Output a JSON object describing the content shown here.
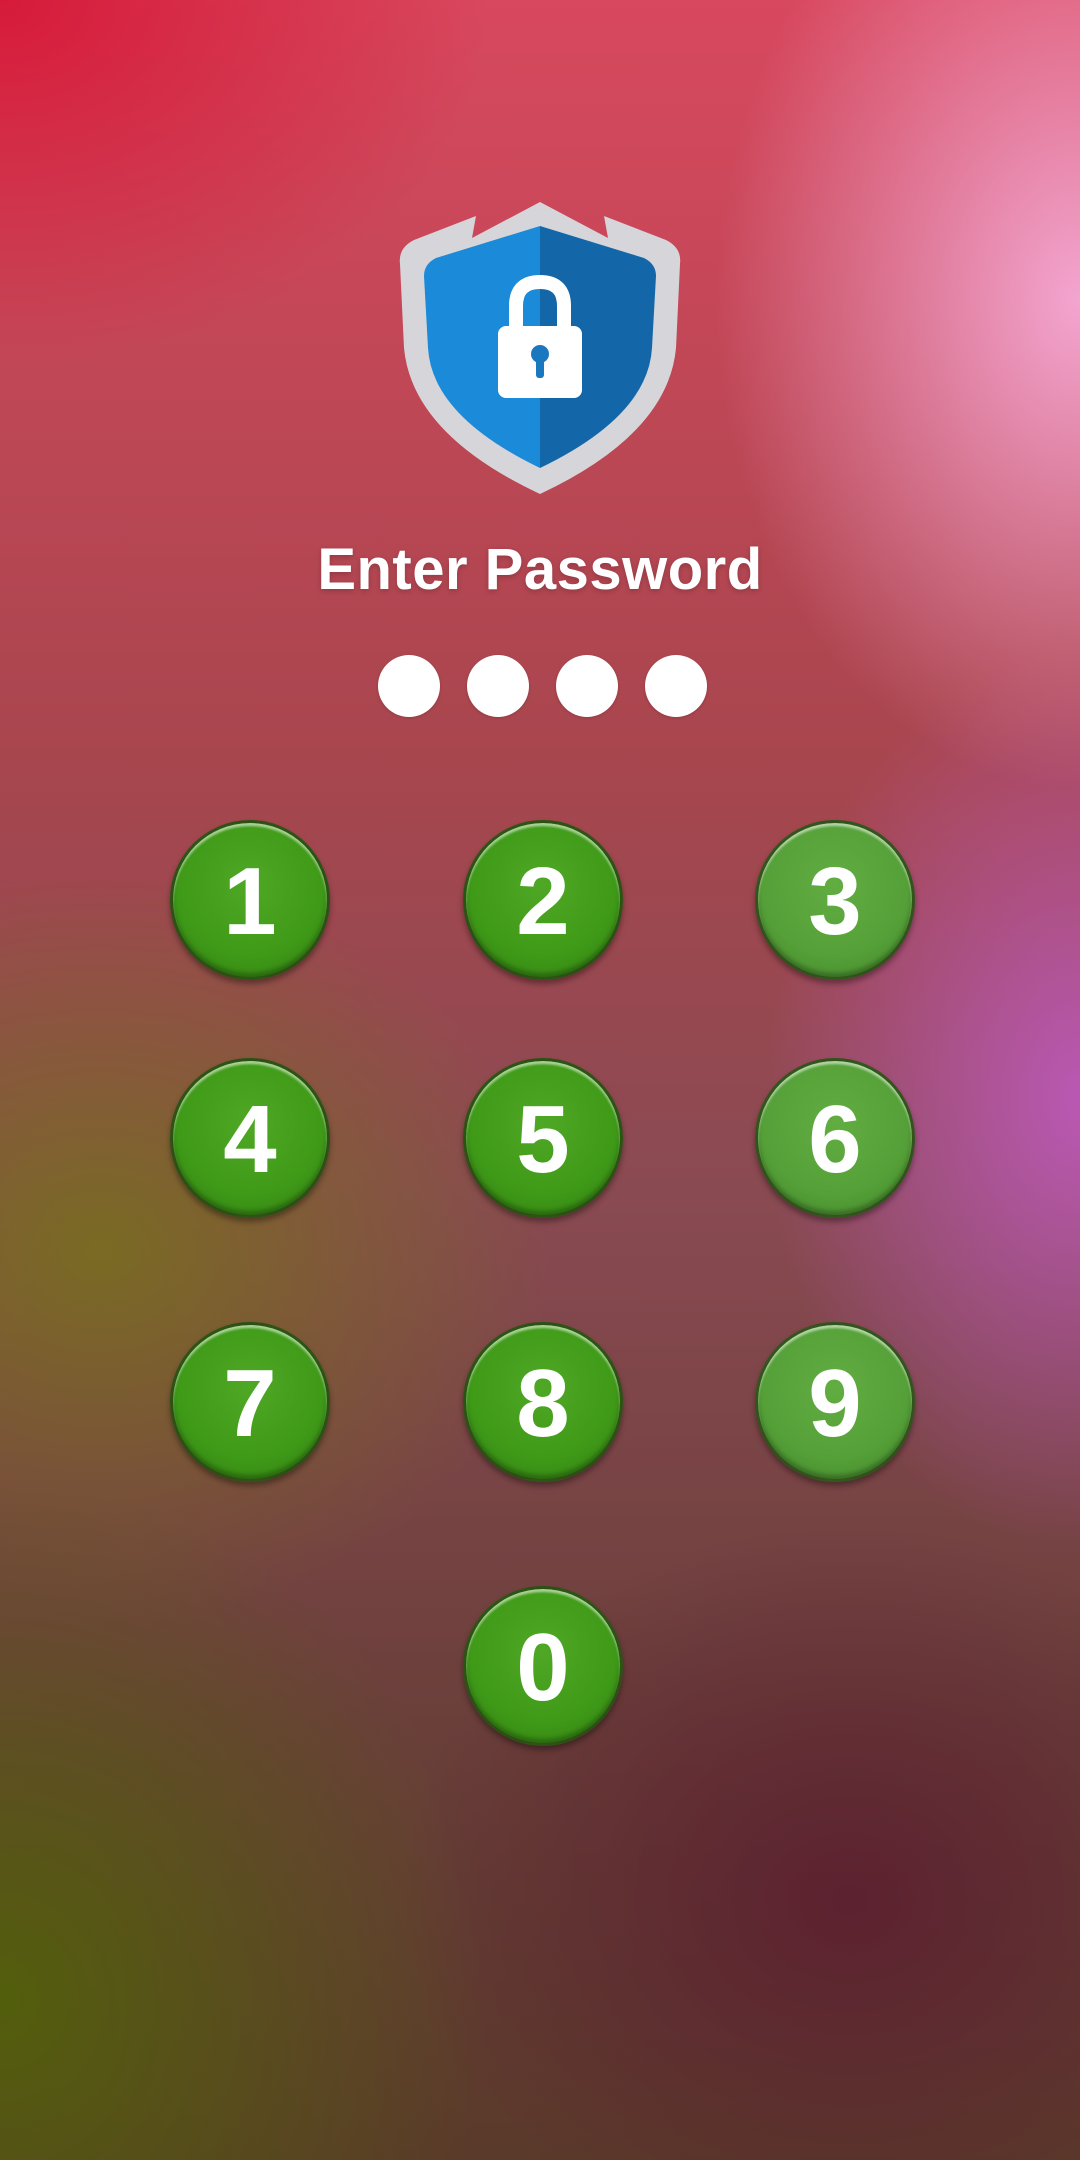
{
  "header": {
    "title": "Enter Password",
    "shield_icon": "shield-lock-icon",
    "shield_colors": {
      "outer": "#d3d3d6",
      "left": "#1b8ad8",
      "right": "#1367a8",
      "lock": "#ffffff"
    }
  },
  "pin": {
    "length": 4,
    "indicators": [
      "",
      "",
      "",
      ""
    ]
  },
  "keypad": {
    "keys": [
      "1",
      "2",
      "3",
      "4",
      "5",
      "6",
      "7",
      "8",
      "9",
      "0"
    ],
    "key_color": "#3f9a18"
  }
}
